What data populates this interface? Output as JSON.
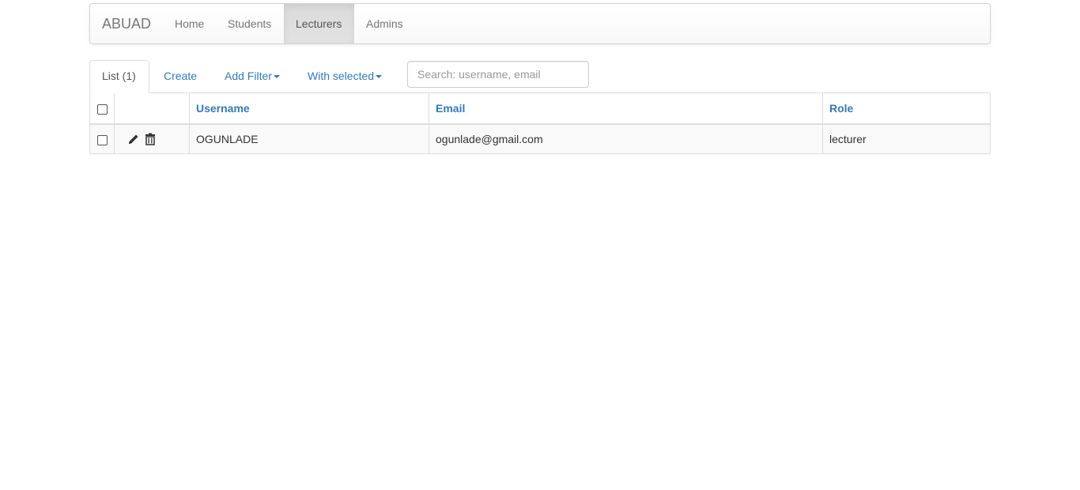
{
  "navbar": {
    "brand": "ABUAD",
    "items": [
      {
        "label": "Home"
      },
      {
        "label": "Students"
      },
      {
        "label": "Lecturers",
        "active": true
      },
      {
        "label": "Admins"
      }
    ]
  },
  "tabs": {
    "list_label": "List (1)",
    "create_label": "Create",
    "add_filter_label": "Add Filter",
    "with_selected_label": "With selected"
  },
  "search": {
    "placeholder": "Search: username, email",
    "value": ""
  },
  "table": {
    "columns": [
      "Username",
      "Email",
      "Role"
    ],
    "rows": [
      {
        "username": "OGUNLADE",
        "email": "ogunlade@gmail.com",
        "role": "lecturer"
      }
    ]
  },
  "icons": {
    "row_edit": "pencil-icon",
    "row_delete": "trash-icon",
    "dropdown": "caret-down-icon"
  },
  "colors": {
    "link": "#337ab7",
    "nav_text": "#777777",
    "active_nav_bg": "#e0e0e0"
  }
}
